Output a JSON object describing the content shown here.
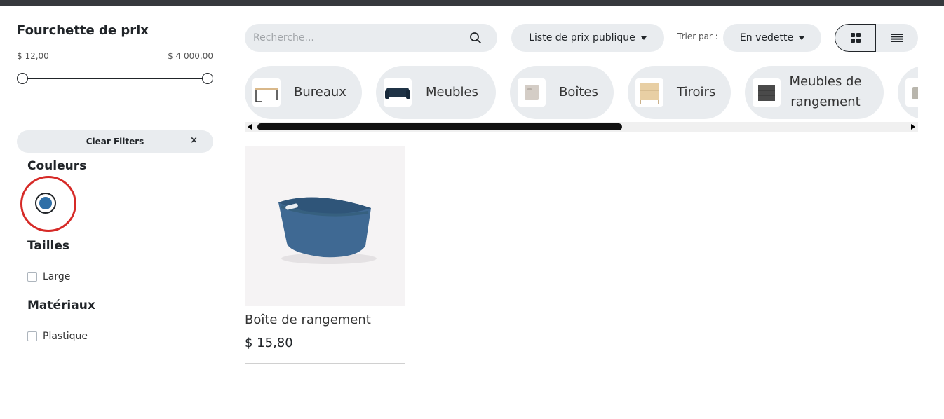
{
  "sidebar": {
    "price_title": "Fourchette de prix",
    "price_min": "$ 12,00",
    "price_max": "$ 4 000,00",
    "clear_label": "Clear Filters",
    "clear_icon": "×",
    "colors_title": "Couleurs",
    "selected_color": "#2e6fa7",
    "sizes_title": "Tailles",
    "sizes": [
      {
        "label": "Large"
      }
    ],
    "materials_title": "Matériaux",
    "materials": [
      {
        "label": "Plastique"
      }
    ]
  },
  "toolbar": {
    "search_placeholder": "Recherche...",
    "pricelist_label": "Liste de prix publique",
    "sort_prefix": "Trier par :",
    "sort_value": "En vedette"
  },
  "categories": [
    {
      "label": "Bureaux"
    },
    {
      "label": "Meubles"
    },
    {
      "label": "Boîtes"
    },
    {
      "label": "Tiroirs"
    },
    {
      "label": "Meubles de rangement"
    }
  ],
  "product": {
    "name": "Boîte de rangement",
    "price": "$ 15,80",
    "color": "#3f6993"
  }
}
